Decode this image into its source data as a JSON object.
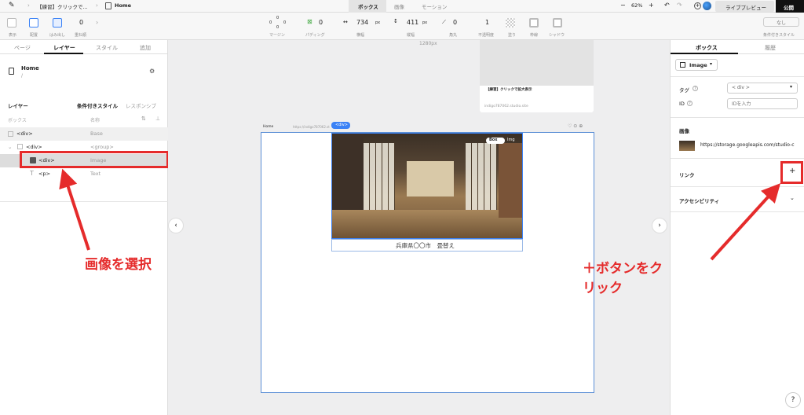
{
  "topbar": {
    "project_title": "【練習】クリックで...",
    "page_name": "Home",
    "tabs": [
      "ボックス",
      "画像",
      "モーション"
    ],
    "zoom": "62%",
    "minus": "−",
    "plus": "+",
    "live_preview": "ライブプレビュー",
    "publish": "公開"
  },
  "toolbar": {
    "display_label": "表示",
    "layout_label": "配置",
    "overflow_label": "はみ出し",
    "zindex_value": "0",
    "zindex_label": "重ね順",
    "margin_label": "マージン",
    "margin_values": [
      "0",
      "0",
      "0",
      "0"
    ],
    "padding_value": "0",
    "padding_label": "パディング",
    "width_value": "734",
    "width_unit": "px",
    "width_label": "横幅",
    "height_value": "411",
    "height_unit": "px",
    "height_label": "縦幅",
    "radius_value": "0",
    "radius_label": "角丸",
    "opacity_value": "1",
    "opacity_label": "不透明度",
    "fill_label": "塗り",
    "border_label": "枠線",
    "shadow_label": "シャドウ",
    "condition_value": "なし",
    "condition_label": "条件付きスタイル"
  },
  "left_panel": {
    "tabs": [
      "ページ",
      "レイヤー",
      "スタイル",
      "追加"
    ],
    "page_title": "Home",
    "page_path": "/",
    "section_title": "レイヤー",
    "subtabs": [
      "条件付きスタイル",
      "レスポンシブ"
    ],
    "col_box": "ボックス",
    "col_name": "名称",
    "rows": [
      {
        "tag": "<div>",
        "name": "Base"
      },
      {
        "tag": "<div>",
        "name": "<group>"
      },
      {
        "tag": "<div>",
        "name": "Image"
      },
      {
        "tag": "<p>",
        "name": "Text"
      }
    ]
  },
  "canvas": {
    "width_label": "1280px",
    "frame_label": "Home",
    "frame_url": "https://indigo787062.st",
    "selected_tag": "<div>",
    "card_title": "【練習】クリックで拡大表示",
    "card_url": "indigo787062.studio.site",
    "image_toggle": [
      "Box",
      "Img"
    ],
    "caption": "兵庫県〇〇市　畳替え"
  },
  "right_panel": {
    "tabs": [
      "ボックス",
      "履歴"
    ],
    "element_type": "Image",
    "tag_label": "タグ",
    "tag_value": "< div >",
    "id_label": "ID",
    "id_placeholder": "IDを入力",
    "image_label": "画像",
    "image_url": "https://storage.googleapis.com/studio-c",
    "link_label": "リンク",
    "link_add": "+",
    "accessibility_label": "アクセシビリティ",
    "help": "?"
  },
  "annotations": {
    "left": "画像を選択",
    "right": "＋ボタンをクリック"
  },
  "colors": {
    "accent": "#3b82f6",
    "annotation": "#e52b2b"
  }
}
